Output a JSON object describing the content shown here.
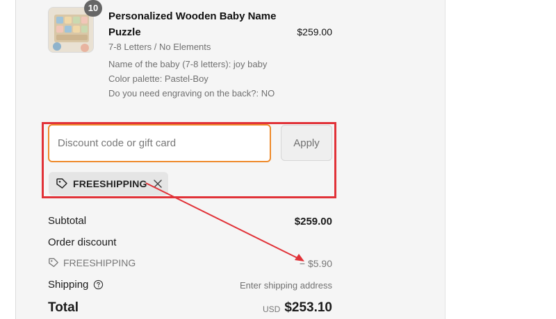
{
  "product": {
    "quantity": "10",
    "title": "Personalized Wooden Baby Name Puzzle",
    "price": "$259.00",
    "variant": "7-8 Letters / No Elements",
    "properties": [
      "Name of the baby (7-8 letters): joy baby",
      "Color palette: Pastel-Boy",
      "Do you need engraving on the back?: NO"
    ]
  },
  "discount": {
    "placeholder": "Discount code or gift card",
    "value": "",
    "apply_label": "Apply",
    "applied_code": "FREESHIPPING"
  },
  "totals": {
    "subtotal_label": "Subtotal",
    "subtotal_value": "$259.00",
    "order_discount_label": "Order discount",
    "discount_code": "FREESHIPPING",
    "discount_value": "− $5.90",
    "shipping_label": "Shipping",
    "shipping_value": "Enter shipping address",
    "total_label": "Total",
    "currency": "USD",
    "total_value": "$253.10"
  },
  "colors": {
    "highlight": "#e13238",
    "input_focus": "#ee8a2a"
  },
  "icons": {
    "tag": "tag-icon",
    "remove": "close-icon",
    "help": "help-circle-icon"
  }
}
